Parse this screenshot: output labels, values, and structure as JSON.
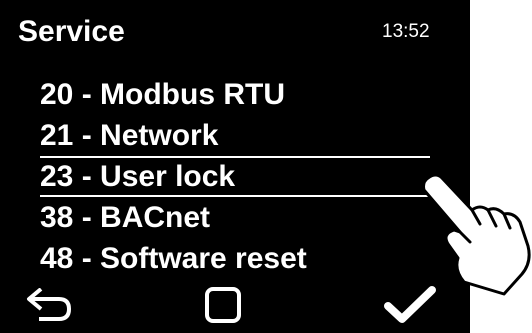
{
  "header": {
    "title": "Service",
    "time": "13:52"
  },
  "menu": {
    "items": [
      {
        "label": "20 - Modbus RTU",
        "selected": false
      },
      {
        "label": "21 - Network",
        "selected": false
      },
      {
        "label": "23 - User lock",
        "selected": true
      },
      {
        "label": "38 - BACnet",
        "selected": false
      },
      {
        "label": "48 - Software reset",
        "selected": false
      }
    ]
  },
  "softkeys": {
    "back_icon": "return-arrow-icon",
    "home_icon": "square-icon",
    "confirm_icon": "checkmark-icon"
  },
  "overlay": {
    "gesture_icon": "pointing-hand-icon"
  },
  "colors": {
    "screen_background": "#000000",
    "text": "#ffffff",
    "page_background": "#ffffff"
  }
}
